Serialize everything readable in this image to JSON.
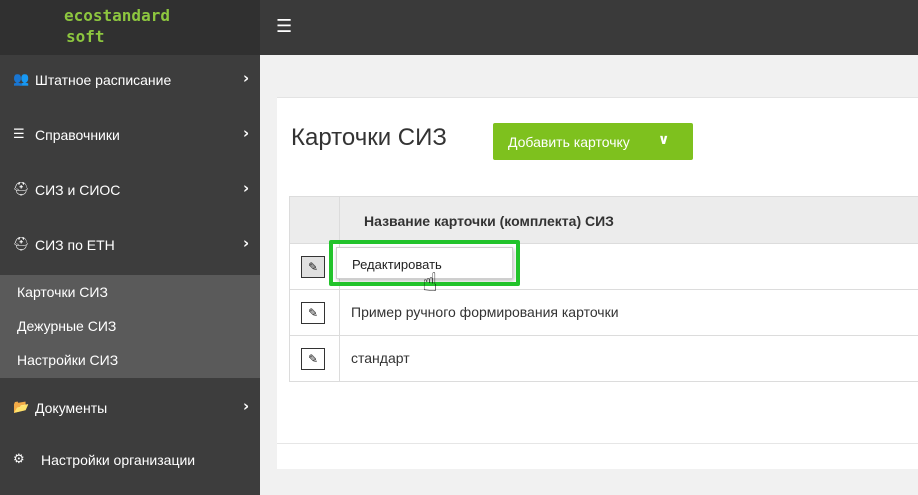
{
  "brand": {
    "line1": "ecostandard",
    "line2": "soft",
    "color": "#8dc63f"
  },
  "topbar": {
    "menu_icon": "hamburger-icon"
  },
  "sidebar": {
    "items": [
      {
        "icon": "users-icon",
        "label": "Штатное расписание"
      },
      {
        "icon": "list-icon",
        "label": "Справочники"
      },
      {
        "icon": "hard-hat-icon",
        "label": "СИЗ и СИОС"
      },
      {
        "icon": "hard-hat-icon",
        "label": "СИЗ по ЕТН"
      }
    ],
    "submenu": [
      {
        "label": "Карточки СИЗ"
      },
      {
        "label": "Дежурные СИЗ"
      },
      {
        "label": "Настройки СИЗ"
      }
    ],
    "bottom_items": [
      {
        "icon": "folder-open-icon",
        "label": "Документы"
      },
      {
        "icon": "gear-icon",
        "label": "Настройки организации"
      }
    ]
  },
  "main": {
    "title": "Карточки СИЗ",
    "add_button": "Добавить карточку",
    "accent": "#7ec11e"
  },
  "table": {
    "column_header": "Название карточки (комплекта) СИЗ",
    "rows": [
      {
        "name": ""
      },
      {
        "name": "Пример ручного формирования карточки"
      },
      {
        "name": "стандарт"
      }
    ]
  },
  "tooltip": {
    "label": "Редактировать",
    "highlight_color": "#22c32b"
  }
}
